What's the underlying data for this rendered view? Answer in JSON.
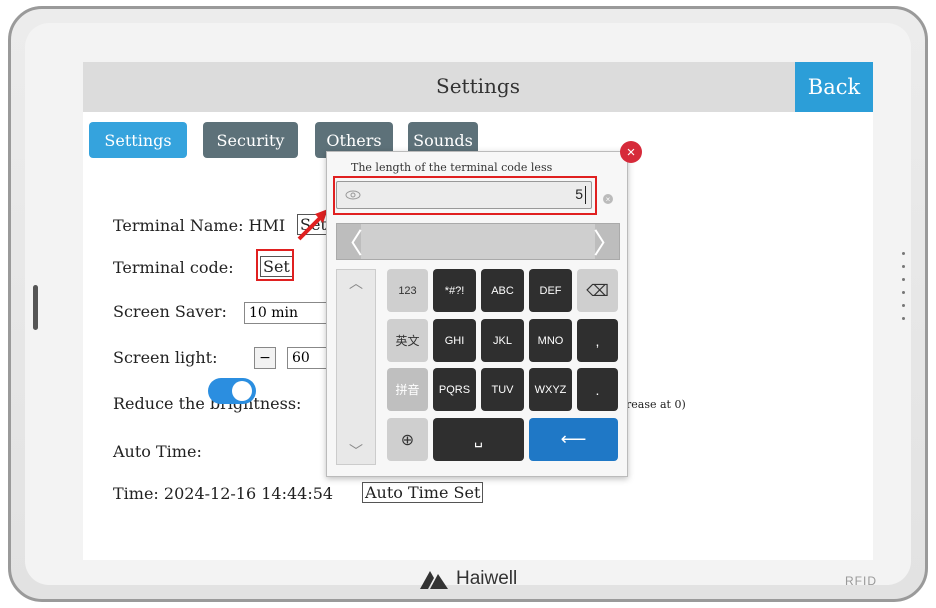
{
  "screen": {
    "title": "Settings",
    "back_label": "Back",
    "tabs": [
      {
        "label": "Settings",
        "active": true
      },
      {
        "label": "Security",
        "active": false
      },
      {
        "label": "Others",
        "active": false
      },
      {
        "label": "Sounds",
        "active": false
      }
    ],
    "terminal_name": {
      "label": "Terminal Name: HMI",
      "set_label": "Set"
    },
    "terminal_code": {
      "label": "Terminal code:",
      "set_label": "Set"
    },
    "screen_saver": {
      "label": "Screen Saver:",
      "value": "10 min"
    },
    "screen_light": {
      "label": "Screen light:",
      "minus_label": "−",
      "value": "60"
    },
    "reduce_brightness": {
      "label": "Reduce the brightness:",
      "hint_tail": "rease at 0)"
    },
    "auto_time": {
      "label": "Auto Time:",
      "enabled": true
    },
    "time": {
      "label": "Time: 2024-12-16 14:44:54",
      "auto_time_set_label": "Auto Time Set"
    }
  },
  "keyboard": {
    "hint": "The length of the terminal code less",
    "input_value": "5",
    "close_symbol": "×",
    "clear_symbol": "×",
    "candidate_left": "〈",
    "candidate_right": "〉",
    "keys": {
      "mode_123": "123",
      "mode_en": "英文",
      "mode_pinyin": "拼音",
      "globe": "⊕",
      "symbols": "*#?!",
      "abc": "ABC",
      "def": "DEF",
      "ghi": "GHI",
      "jkl": "JKL",
      "mno": "MNO",
      "pqrs": "PQRS",
      "tuv": "TUV",
      "wxyz": "WXYZ",
      "comma": ",",
      "period": ".",
      "backspace": "⌫",
      "space": "␣",
      "enter": "⟵"
    }
  },
  "device": {
    "brand": "Haiwell",
    "rfid": "RFID"
  },
  "colors": {
    "accent": "#2c9ed8",
    "tab_inactive": "#5d7179",
    "highlight": "#e02020",
    "enter_key": "#1f78c6"
  }
}
